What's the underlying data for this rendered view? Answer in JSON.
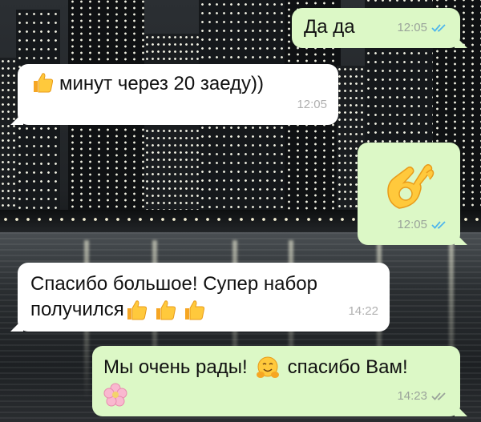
{
  "messages": [
    {
      "direction": "outgoing",
      "text": "Да да",
      "time": "12:05",
      "read": true
    },
    {
      "direction": "incoming",
      "text": "минут через 20 заеду))",
      "time": "12:05",
      "leading_emoji": "thumbs-up"
    },
    {
      "direction": "outgoing",
      "emoji": "ok-hand",
      "time": "12:05",
      "read": true
    },
    {
      "direction": "incoming",
      "text_line1": "Спасибо большое! Супер набор",
      "text_line2": "получился",
      "trailing_emoji": [
        "thumbs-up",
        "thumbs-up",
        "thumbs-up"
      ],
      "time": "14:22"
    },
    {
      "direction": "outgoing",
      "text_part1": "Мы очень рады!",
      "text_part2": "спасибо Вам!",
      "inline_emoji": "hugging-face",
      "second_line_emoji": "cherry-blossom",
      "time": "14:23",
      "read": false
    }
  ],
  "colors": {
    "incoming_bubble": "#ffffff",
    "outgoing_bubble": "#dcf8c6",
    "read_ticks": "#4fb6ec",
    "delivered_ticks": "#9aa39a"
  }
}
